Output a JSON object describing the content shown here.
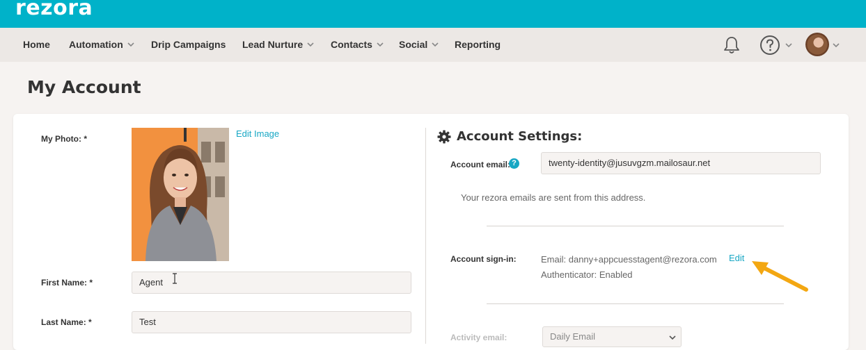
{
  "brand": {
    "logo_text": "rezora",
    "accent": "#00b2c9",
    "link_color": "#17a7c4"
  },
  "nav": {
    "items": [
      {
        "label": "Home",
        "has_dropdown": false
      },
      {
        "label": "Automation",
        "has_dropdown": true
      },
      {
        "label": "Drip Campaigns",
        "has_dropdown": false
      },
      {
        "label": "Lead Nurture",
        "has_dropdown": true
      },
      {
        "label": "Contacts",
        "has_dropdown": true
      },
      {
        "label": "Social",
        "has_dropdown": true
      },
      {
        "label": "Reporting",
        "has_dropdown": false
      }
    ],
    "icons": [
      "bell-icon",
      "help-circle-icon",
      "avatar"
    ]
  },
  "page": {
    "title": "My Account"
  },
  "profile": {
    "photo_label": "My Photo: *",
    "edit_image_label": "Edit Image",
    "first_name_label": "First Name: *",
    "first_name_value": "Agent",
    "last_name_label": "Last Name: *",
    "last_name_value": "Test"
  },
  "settings": {
    "title": "Account Settings:",
    "account_email_label": "Account email:",
    "help_glyph": "?",
    "account_email_value": "twenty-identity@jusuvgzm.mailosaur.net",
    "account_email_note": "Your rezora emails are sent from this address.",
    "sign_in_label": "Account sign-in:",
    "sign_in_email": "Email: danny+appcuesstagent@rezora.com",
    "sign_in_authenticator": "Authenticator: Enabled",
    "edit_label": "Edit",
    "activity_email_label": "Activity email:",
    "activity_email_value": "Daily Email"
  }
}
